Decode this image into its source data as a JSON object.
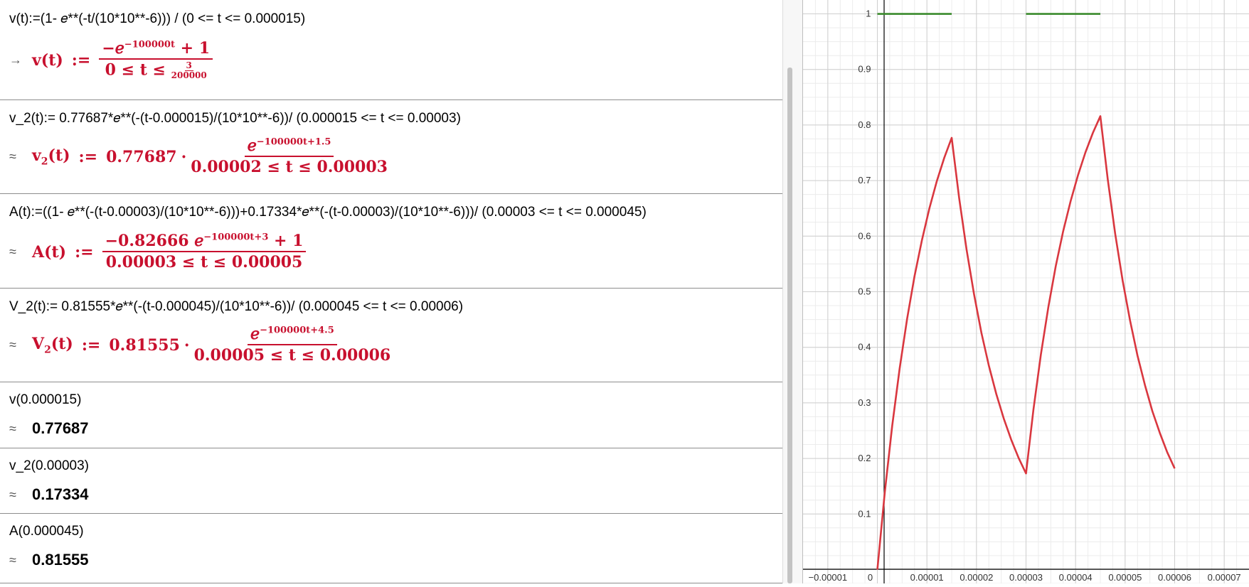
{
  "algebra": {
    "rows": [
      {
        "input": "v(t):=(1- 𝑒**(-t/(10*10**-6))) / (0 <= t <= 0.000015)",
        "out_symbol": "→",
        "lhs_name": "v",
        "lhs_arg": "(t)",
        "assign": ":=",
        "numerator_pre": "−𝑒",
        "numerator_exp": "−100000t",
        "numerator_post": "+ 1",
        "den_pre": "0 ≤ t ≤",
        "den_frac_num": "3",
        "den_frac_den": "200000"
      },
      {
        "input": "v_2(t):= 0.77687*𝑒**(-(t-0.000015)/(10*10**-6))/ (0.000015 <= t <= 0.00003)",
        "out_symbol": "≈",
        "lhs_name": "v",
        "lhs_sub": "2",
        "lhs_arg": "(t)",
        "assign": ":=",
        "coef": "0.77687",
        "dot": "·",
        "numerator_pre": "𝑒",
        "numerator_exp": "−100000t+1.5",
        "denominator": "0.00002 ≤ t ≤ 0.00003"
      },
      {
        "input": "A(t):=((1- 𝑒**(-(t-0.00003)/(10*10**-6)))+0.17334*𝑒**(-(t-0.00003)/(10*10**-6)))/ (0.00003 <= t <= 0.000045)",
        "out_symbol": "≈",
        "lhs_name": "A",
        "lhs_arg": "(t)",
        "assign": ":=",
        "numerator_pre": "−0.82666 𝑒",
        "numerator_exp": "−100000t+3",
        "numerator_post": "+ 1",
        "denominator": "0.00003 ≤ t ≤ 0.00005"
      },
      {
        "input": "V_2(t):= 0.81555*𝑒**(-(t-0.000045)/(10*10**-6))/ (0.000045 <= t <= 0.00006)",
        "out_symbol": "≈",
        "lhs_name": "V",
        "lhs_sub": "2",
        "lhs_arg": "(t)",
        "assign": ":=",
        "coef": "0.81555",
        "dot": "·",
        "numerator_pre": "𝑒",
        "numerator_exp": "−100000t+4.5",
        "denominator": "0.00005 ≤ t ≤ 0.00006"
      },
      {
        "input": "v(0.000015)",
        "out_symbol": "≈",
        "value": "0.77687"
      },
      {
        "input": "v_2(0.00003)",
        "out_symbol": "≈",
        "value": "0.17334"
      },
      {
        "input": "A(0.000045)",
        "out_symbol": "≈",
        "value": "0.81555"
      }
    ]
  },
  "graphics": {
    "colors": {
      "curve": "#d9373f",
      "green": "#3a8a2c",
      "axis": "#000000",
      "grid_major": "#cfcfcf",
      "grid_minor": "#ececec"
    },
    "x_ticks": [
      "−0.00001",
      "0",
      "0.00001",
      "0.00002",
      "0.00003",
      "0.00004",
      "0.00005",
      "0.00006",
      "0.00007"
    ],
    "y_ticks": [
      "0.1",
      "0.2",
      "0.3",
      "0.4",
      "0.5",
      "0.6",
      "0.7",
      "0.8",
      "0.9",
      "1"
    ]
  },
  "chart_data": {
    "type": "line",
    "title": "",
    "xlabel": "",
    "ylabel": "",
    "xlim": [
      -1.5e-05,
      7.5e-05
    ],
    "ylim": [
      -0.025,
      1.025
    ],
    "grid": true,
    "series": [
      {
        "x": [
          0,
          1.5e-06,
          3e-06,
          4.5e-06,
          6e-06,
          7.5e-06,
          9e-06,
          1.05e-05,
          1.2e-05,
          1.35e-05,
          1.5e-05,
          1.65e-05,
          1.8e-05,
          1.95e-05,
          2.1e-05,
          2.25e-05,
          2.4e-05,
          2.55e-05,
          2.7e-05,
          2.85e-05,
          3e-05,
          3.15e-05,
          3.3e-05,
          3.45e-05,
          3.6e-05,
          3.75e-05,
          3.9e-05,
          4.05e-05,
          4.2e-05,
          4.35e-05,
          4.5e-05,
          4.65e-05,
          4.8e-05,
          4.95e-05,
          5.1e-05,
          5.25e-05,
          5.4e-05,
          5.55e-05,
          5.7e-05,
          5.85e-05,
          6e-05
        ],
        "y": [
          0,
          0.139,
          0.259,
          0.362,
          0.451,
          0.528,
          0.593,
          0.65,
          0.699,
          0.741,
          0.777,
          0.669,
          0.576,
          0.496,
          0.426,
          0.367,
          0.316,
          0.272,
          0.234,
          0.201,
          0.173,
          0.288,
          0.387,
          0.472,
          0.546,
          0.609,
          0.663,
          0.71,
          0.751,
          0.786,
          0.816,
          0.702,
          0.604,
          0.52,
          0.448,
          0.385,
          0.332,
          0.285,
          0.246,
          0.211,
          0.182
        ]
      },
      {
        "x": [
          0,
          1.5e-05,
          3e-05,
          4.5e-05
        ],
        "y": [
          1,
          1,
          1,
          1
        ]
      }
    ]
  }
}
